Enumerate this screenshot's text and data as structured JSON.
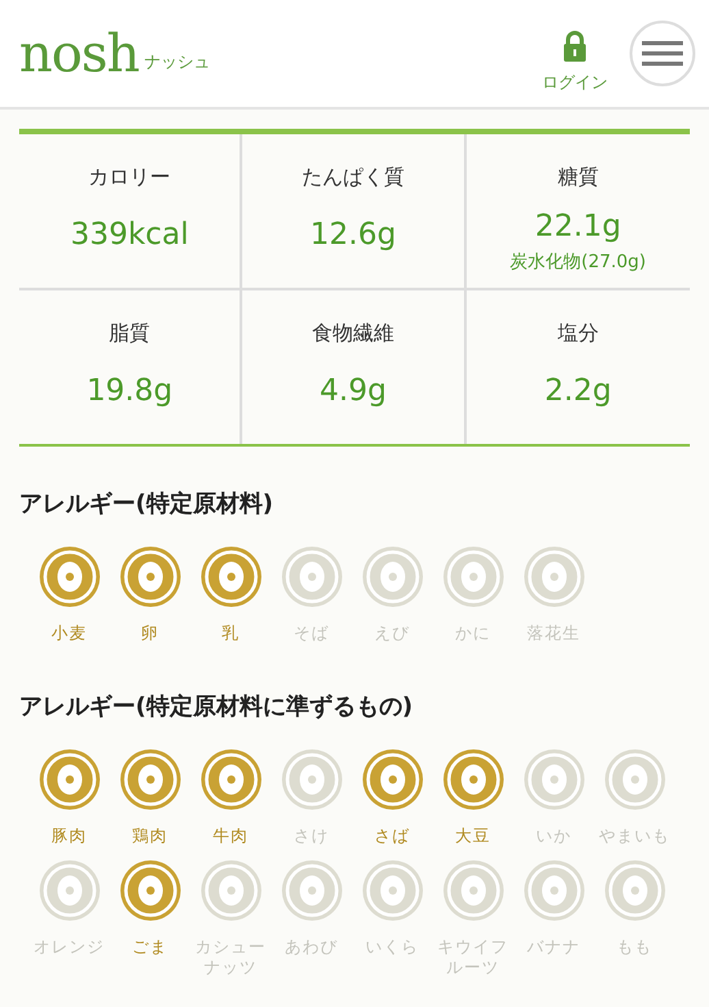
{
  "header": {
    "logo": "nosh",
    "logo_kana": "ナッシュ",
    "login": "ログイン"
  },
  "nutrition": [
    {
      "label": "カロリー",
      "value": "339kcal"
    },
    {
      "label": "たんぱく質",
      "value": "12.6g"
    },
    {
      "label": "糖質",
      "value": "22.1g",
      "sub": "炭水化物(27.0g)"
    },
    {
      "label": "脂質",
      "value": "19.8g"
    },
    {
      "label": "食物繊維",
      "value": "4.9g"
    },
    {
      "label": "塩分",
      "value": "2.2g"
    }
  ],
  "allergen_sections": [
    {
      "title": "アレルギー(特定原材料)",
      "items": [
        {
          "label": "小麦",
          "active": true
        },
        {
          "label": "卵",
          "active": true
        },
        {
          "label": "乳",
          "active": true
        },
        {
          "label": "そば",
          "active": false
        },
        {
          "label": "えび",
          "active": false
        },
        {
          "label": "かに",
          "active": false
        },
        {
          "label": "落花生",
          "active": false
        }
      ]
    },
    {
      "title": "アレルギー(特定原材料に準ずるもの)",
      "items": [
        {
          "label": "豚肉",
          "active": true
        },
        {
          "label": "鶏肉",
          "active": true
        },
        {
          "label": "牛肉",
          "active": true
        },
        {
          "label": "さけ",
          "active": false
        },
        {
          "label": "さば",
          "active": true
        },
        {
          "label": "大豆",
          "active": true
        },
        {
          "label": "いか",
          "active": false
        },
        {
          "label": "やまいも",
          "active": false
        },
        {
          "label": "オレンジ",
          "active": false
        },
        {
          "label": "ごま",
          "active": true
        },
        {
          "label": "カシューナッツ",
          "active": false
        },
        {
          "label": "あわび",
          "active": false
        },
        {
          "label": "いくら",
          "active": false
        },
        {
          "label": "キウイフルーツ",
          "active": false
        },
        {
          "label": "バナナ",
          "active": false
        },
        {
          "label": "もも",
          "active": false
        }
      ]
    }
  ]
}
